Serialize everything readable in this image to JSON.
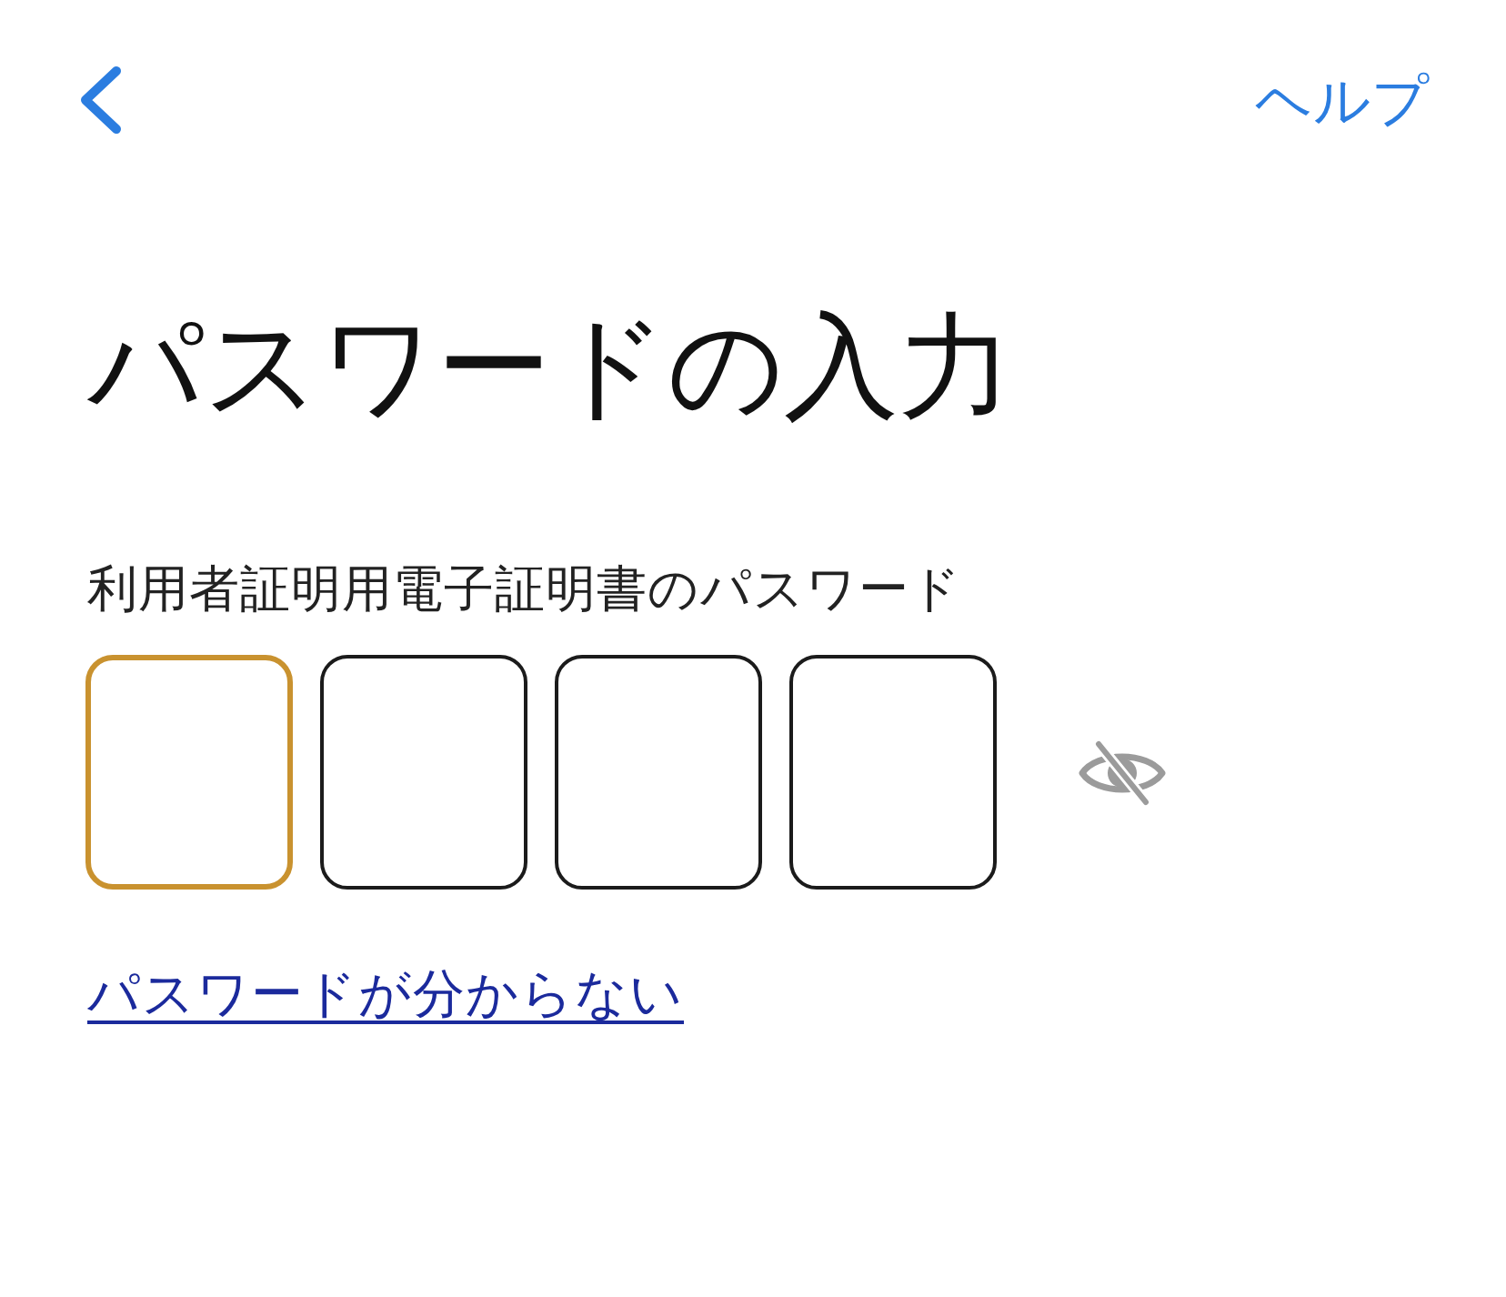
{
  "header": {
    "help_link": "ヘルプ"
  },
  "title": "パスワードの入力",
  "password": {
    "label": "利用者証明用電子証明書のパスワード",
    "digits": [
      {
        "focused": true
      },
      {
        "focused": false
      },
      {
        "focused": false
      },
      {
        "focused": false
      }
    ],
    "reveal_toggle": {
      "masked": true
    }
  },
  "forgot_link": "パスワードが分からない"
}
